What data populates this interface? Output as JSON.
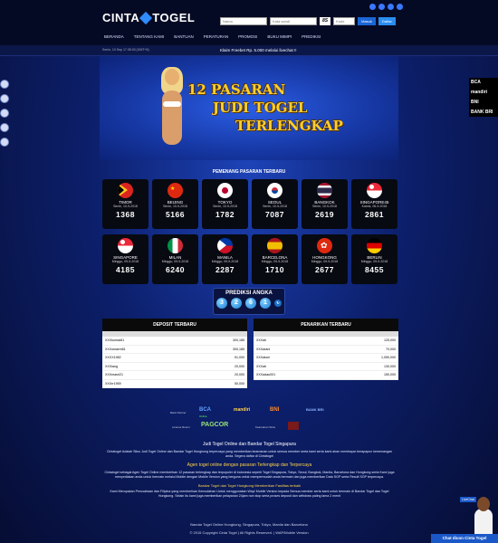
{
  "header": {
    "logo_text_1": "CINTA",
    "logo_text_2": "TOGEL",
    "username_placeholder": "Nama",
    "password_placeholder": "Kata sandi",
    "captcha": "8S",
    "code_placeholder": "Kode",
    "login_label": "Masuk",
    "register_label": "Daftar"
  },
  "nav": {
    "items": [
      "BERANDA",
      "TENTANG KAMI",
      "BANTUAN",
      "PERATURAN",
      "PROMOSI",
      "BUKU MIMPI",
      "PREDIKSI"
    ]
  },
  "ticker": {
    "clock": "Senin, 10 Sep 17:35:03 (GMT+8)",
    "marquee": "Klaim Freebet Rp. 5.000 melalui livechat !!"
  },
  "banner": {
    "line1": "12 PASARAN",
    "line2": "JUDI TOGEL",
    "line3": "TERLENGKAP"
  },
  "banks": [
    "BCA",
    "mandiri",
    "BNI",
    "BANK BRI"
  ],
  "winners": {
    "title": "PEMENANG PASARAN TERBARU",
    "markets": [
      {
        "name": "TIMOR",
        "date": "Senin, 10-9-2018",
        "number": "1368",
        "flag": "timor"
      },
      {
        "name": "BEIJING",
        "date": "Senin, 10-9-2018",
        "number": "5166",
        "flag": "china"
      },
      {
        "name": "TOKYO",
        "date": "Senin, 10-9-2018",
        "number": "1782",
        "flag": "japan"
      },
      {
        "name": "SEOUL",
        "date": "Senin, 10-9-2018",
        "number": "7087",
        "flag": "korea"
      },
      {
        "name": "BANGKOK",
        "date": "Senin, 10-9-2018",
        "number": "2619",
        "flag": "thailand"
      },
      {
        "name": "SINGAPORE45",
        "date": "Kamis, 06-9-2018",
        "number": "2861",
        "flag": "singapore"
      },
      {
        "name": "SINGAPORE",
        "date": "Minggu, 09-9-2018",
        "number": "4185",
        "flag": "singapore"
      },
      {
        "name": "MILAN",
        "date": "Minggu, 09-9-2018",
        "number": "6240",
        "flag": "italy"
      },
      {
        "name": "MANILA",
        "date": "Minggu, 09-9-2018",
        "number": "2287",
        "flag": "philippines"
      },
      {
        "name": "BARCELONA",
        "date": "Minggu, 09-9-2018",
        "number": "1710",
        "flag": "spain"
      },
      {
        "name": "HONGKONG",
        "date": "Minggu, 09-9-2018",
        "number": "2677",
        "flag": "hongkong"
      },
      {
        "name": "BERLIN",
        "date": "Minggu, 09-9-2018",
        "number": "8455",
        "flag": "germany"
      }
    ]
  },
  "prediction": {
    "title": "PREDIKSI ANGKA",
    "digits": [
      "3",
      "2",
      "6",
      "1"
    ]
  },
  "deposits": {
    "title": "DEPOSIT TERBARU",
    "rows": [
      [
        "XXXkomar81",
        "300,185"
      ],
      [
        "XXXomarrb81",
        "300,185"
      ],
      [
        "XXXX1982",
        "51,000"
      ],
      [
        "XXXiang",
        "20,000"
      ],
      [
        "XXXmasri21",
        "20,000"
      ],
      [
        "XXXrr1959",
        "50,000"
      ]
    ]
  },
  "withdrawals": {
    "title": "PENARIKAN TERBARU",
    "rows": [
      [
        "XXXah",
        "125,000"
      ],
      [
        "XXXarani",
        "70,000"
      ],
      [
        "XXXatoni",
        "1,050,000"
      ],
      [
        "XXXah",
        "130,000"
      ],
      [
        "XXXadau001",
        "150,000"
      ]
    ]
  },
  "partners": {
    "bank_label": "Bank Partner",
    "license_label": "License Resmi",
    "security_label": "Keamanan Situs",
    "logos": [
      "BCA",
      "mandiri",
      "BNI",
      "BANK BRI",
      "PAGCOR"
    ],
    "online": "Online"
  },
  "footer": {
    "heading1": "Judi Togel Online dan Bandar Togel Singapura",
    "para1": "Cintatogel Adalah Situs Judi Togel Online dan Bandar Togel Hongkong terpercaya yang memberikan keamanan untuk semua member serta kami serta kami akan membayar berapapun kemenangan anda. Segera daftar di Cintatogel",
    "heading2": "Agen togel online dengan pasaran Terlengkap dan Terpercaya",
    "para2": "Cintatogel sebagai Agen Togel Online memberikan 12 pasaran terlengkap dan terpopuler di indonesia seperti Togel Singapura, Tokyo, Seoul, Bangkok, Manila, Barcelona dan Hongkong serta Kami juga menyediakan anda untuk bermain melalui Mobile dengan Mobile Version yang berguna untuk mempermudah anda bermain dan juga memberikan Data SGP serta Result SGP terpercaya.",
    "heading3": "Bandar Togel dan Togel Hongkong Memberikan Fasilitas terbaik",
    "para3": "Kami Merupakan Perusahaan dan Filipina yang memberikan Kemudahan Untuk menggunakan Wap/ Mobile Version kepada Semua member serta kami untuk bermain di Bandar Togel dan Togel Hongkong. Selain itu kami juga memberikan pelayanan 24jam non stop serta proses deposit dan withdraw paling lama 2 menit",
    "links": "Bandar Togel Online Hongkong, Singapura, Tokyo, Manila dan Barcelona",
    "copyright": "© 2015 Copyright Cinta Togel | All Rights Reserved. | WAP/Mobile Version"
  },
  "livechat": {
    "tag": "LiveChat",
    "label": "Chat dicon Cinta Togel"
  }
}
